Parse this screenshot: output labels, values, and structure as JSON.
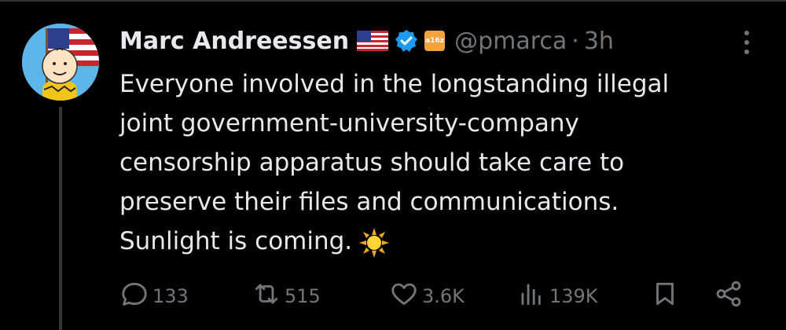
{
  "tweet": {
    "author_name": "Marc Andreessen",
    "badge_label": "a16z",
    "handle": "@pmarca",
    "separator": "·",
    "timestamp": "3h",
    "text_lines": [
      "Everyone involved in the longstanding illegal",
      "joint government-university-company",
      "censorship apparatus should take care to",
      "preserve their files and communications.",
      "Sunlight is coming."
    ]
  },
  "actions": {
    "reply_count": "133",
    "retweet_count": "515",
    "like_count": "3.6K",
    "view_count": "139K"
  },
  "icons": [
    "avatar",
    "us-flag-icon",
    "verified-icon",
    "a16z-badge-icon",
    "more-icon",
    "sun-icon",
    "reply-icon",
    "retweet-icon",
    "like-icon",
    "views-icon",
    "bookmark-icon",
    "share-icon"
  ],
  "colors": {
    "background": "#000000",
    "text_primary": "#e7e9ea",
    "text_secondary": "#71767b",
    "verified_blue": "#1d9bf0",
    "badge_orange": "#f2a33a"
  }
}
